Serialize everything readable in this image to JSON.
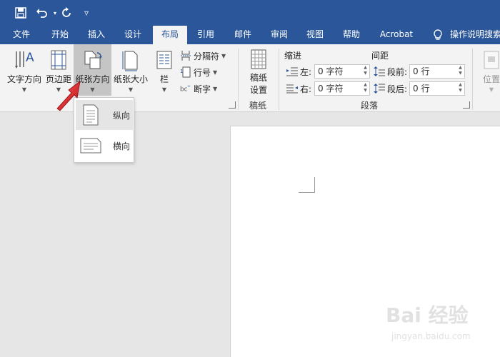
{
  "title_bar": {
    "quick_access": [
      {
        "name": "save",
        "glyph": "💾"
      },
      {
        "name": "undo",
        "glyph": "↶"
      },
      {
        "name": "redo",
        "glyph": "↻"
      },
      {
        "name": "customize",
        "glyph": "▿"
      }
    ]
  },
  "tabs": [
    {
      "label": "文件",
      "active": false
    },
    {
      "label": "开始",
      "active": false
    },
    {
      "label": "插入",
      "active": false
    },
    {
      "label": "设计",
      "active": false
    },
    {
      "label": "布局",
      "active": true
    },
    {
      "label": "引用",
      "active": false
    },
    {
      "label": "邮件",
      "active": false
    },
    {
      "label": "审阅",
      "active": false
    },
    {
      "label": "视图",
      "active": false
    },
    {
      "label": "帮助",
      "active": false
    },
    {
      "label": "Acrobat",
      "active": false
    },
    {
      "label": "操作说明搜索",
      "active": false
    }
  ],
  "ribbon": {
    "page_setup": {
      "text_direction": "文字方向",
      "margins": "页边距",
      "orientation": "纸张方向",
      "size": "纸张大小",
      "columns": "栏",
      "breaks": "分隔符",
      "line_numbers": "行号",
      "hyphenation": "断字"
    },
    "manuscript": {
      "settings_line1": "稿纸",
      "settings_line2": "设置",
      "group_label": "稿纸"
    },
    "paragraph": {
      "indent_header": "缩进",
      "spacing_header": "间距",
      "left_label": "左:",
      "left_value": "0 字符",
      "right_label": "右:",
      "right_value": "0 字符",
      "before_label": "段前:",
      "before_value": "0 行",
      "after_label": "段后:",
      "after_value": "0 行",
      "group_label": "段落"
    },
    "arrange": {
      "position": "位置"
    }
  },
  "orientation_menu": {
    "portrait": "纵向",
    "landscape": "横向"
  },
  "watermark": {
    "text": "Bai 经验",
    "url": "jingyan.baidu.com"
  },
  "colors": {
    "title_bar": "#2b579a",
    "ribbon": "#f3f3f3",
    "arrow": "#e8262a"
  }
}
